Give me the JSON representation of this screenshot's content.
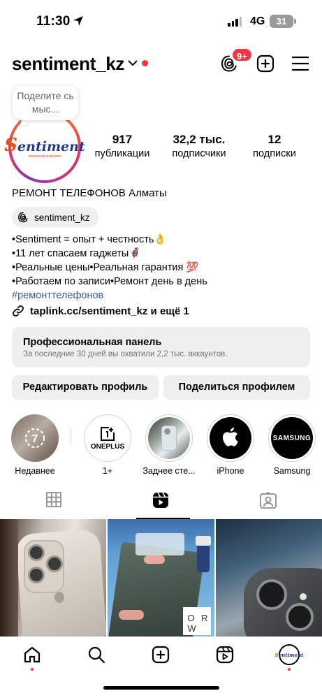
{
  "status_bar": {
    "time": "11:30",
    "network": "4G",
    "battery": "31"
  },
  "header": {
    "username": "sentiment_kz",
    "notification_badge": "9+"
  },
  "note": {
    "text": "Поделите сь мыс..."
  },
  "avatar": {
    "logo_text": "entiment",
    "logo_letter": "S",
    "logo_sub": "сервисная компания"
  },
  "stats": [
    {
      "value": "917",
      "label": "публикации"
    },
    {
      "value": "32,2 тыс.",
      "label": "подписчики"
    },
    {
      "value": "12",
      "label": "подписки"
    }
  ],
  "bio": {
    "title": "РЕМОНТ ТЕЛЕФОНОВ Алматы",
    "threads_handle": "sentiment_kz",
    "lines": [
      "•Sentiment = опыт + честность👌",
      "•11 лет спасаем гаджеты🦸",
      "•Реальные цены•Реальная гарантия 💯",
      "•Работаем по записи•Ремонт день в день"
    ],
    "hashtag": "#ремонттелефонов",
    "link": "taplink.cc/sentiment_kz и ещё 1"
  },
  "pro_panel": {
    "title": "Профессиональная панель",
    "subtitle": "За последние 30 дней вы охватили 2,2 тыс. аккаунтов."
  },
  "buttons": {
    "edit": "Редактировать профиль",
    "share": "Поделиться профилем"
  },
  "highlights": [
    {
      "label": "Недавнее",
      "icon": "recent-icon"
    },
    {
      "label": "1+",
      "icon": "oneplus-logo",
      "logo_text": "ONEPLUS"
    },
    {
      "label": "Заднее сте...",
      "icon": "phone-back-image"
    },
    {
      "label": "iPhone",
      "icon": "apple-logo"
    },
    {
      "label": "Samsung",
      "icon": "samsung-logo",
      "logo_text": "SAMSUNG"
    }
  ],
  "tabs": [
    "grid-icon",
    "reels-icon",
    "tagged-icon"
  ],
  "grid_posts": [
    {
      "type": "photo",
      "subject": "white iPhone back"
    },
    {
      "type": "photo",
      "subject": "glass repair on table"
    },
    {
      "type": "photo",
      "subject": "iPhone camera closeup"
    }
  ],
  "overlay_text": "O R W",
  "bottom_nav": [
    "home-icon",
    "search-icon",
    "create-icon",
    "reels-icon",
    "profile-avatar"
  ],
  "colors": {
    "accent_red": "#ff3040",
    "link_blue": "#385a97",
    "chip_bg": "#efefef"
  }
}
